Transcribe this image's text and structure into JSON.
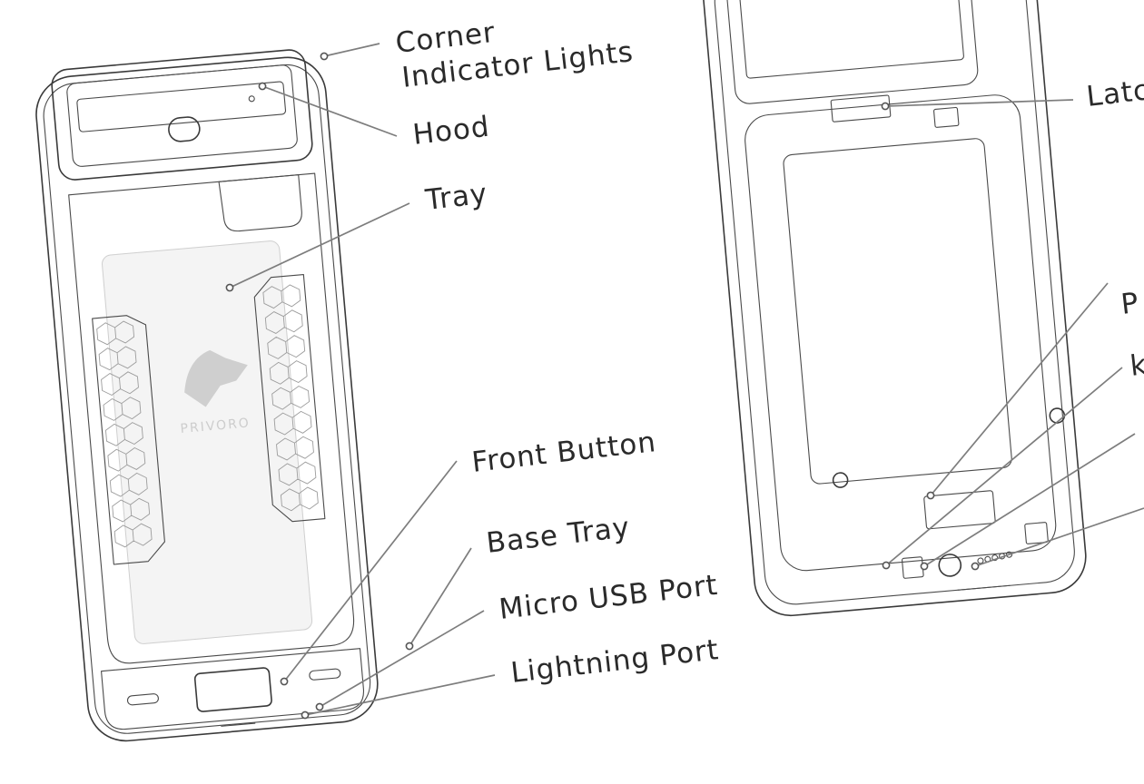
{
  "brand_text": "PRIVORO",
  "labels": {
    "corner_line1": "Corner",
    "corner_line2": "Indicator Lights",
    "hood": "Hood",
    "tray": "Tray",
    "front_button": "Front Button",
    "base_tray": "Base Tray",
    "micro_usb": "Micro USB Port",
    "lightning": "Lightning Port",
    "latch_partial": "Latc",
    "p_partial": "P",
    "k_partial": "k"
  },
  "colors": {
    "outline": "#3a3a3a",
    "leader": "#7d7d7d",
    "text": "#2a2a2a",
    "watermark": "#cdcdcd"
  }
}
